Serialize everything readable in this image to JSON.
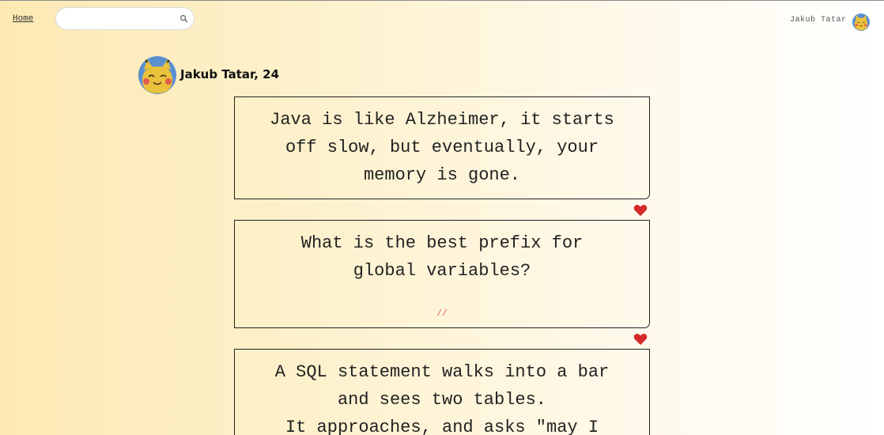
{
  "nav": {
    "home_label": "Home",
    "search": {
      "value": "",
      "placeholder": ""
    },
    "user_name": "Jakub Tatar"
  },
  "profile": {
    "title": "Jakub Tatar, 24"
  },
  "posts": [
    {
      "lines": [
        "Java is like Alzheimer, it starts",
        "off slow, but eventually, your",
        "memory is gone."
      ],
      "comment": ""
    },
    {
      "lines": [
        "What is the best prefix for",
        "global variables?"
      ],
      "comment": "//"
    },
    {
      "lines": [
        "A SQL statement walks into a bar",
        "and sees two tables.",
        "It approaches, and asks \"may I"
      ],
      "comment": ""
    }
  ],
  "colors": {
    "heart": "#d42a2a",
    "avatar_bg": "#5b8fd0",
    "avatar_face": "#e9c13b",
    "comment": "#d9534f"
  },
  "icons": {
    "search": "search-icon",
    "like": "heart-icon",
    "avatar": "avatar-icon"
  }
}
